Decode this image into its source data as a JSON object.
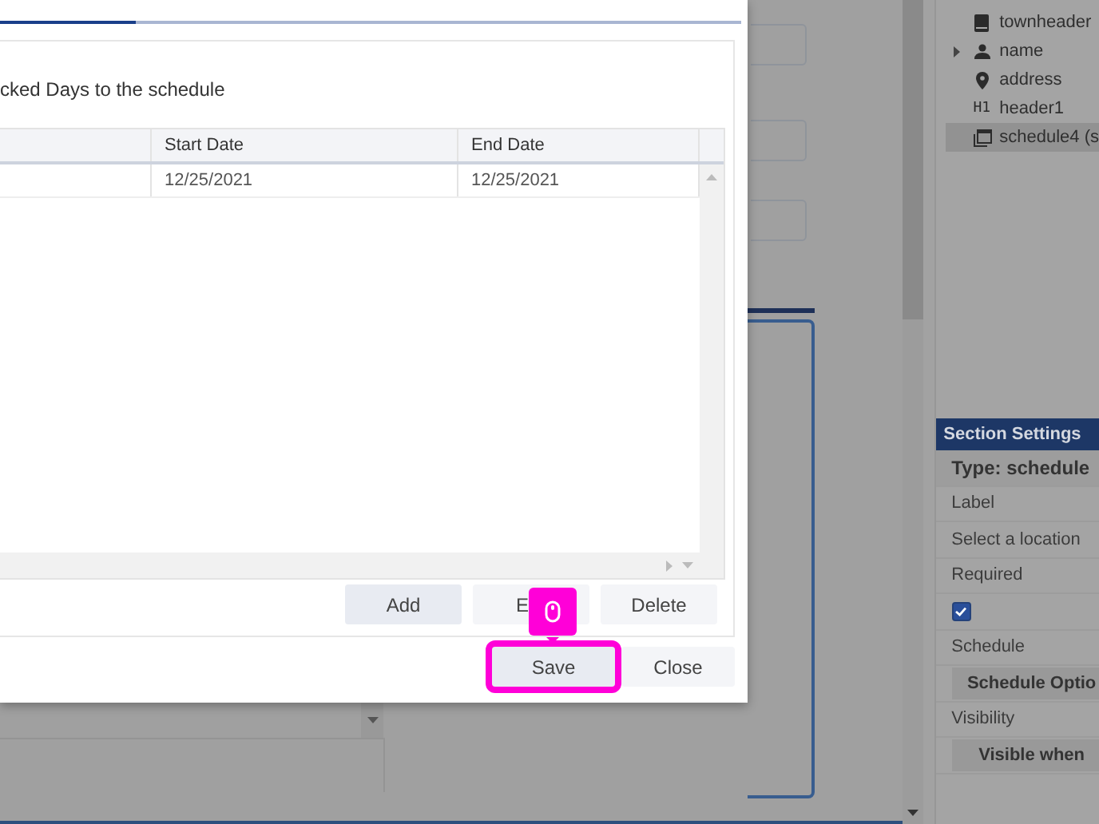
{
  "dialog": {
    "intro": "cked Days to the schedule",
    "table": {
      "columns": [
        {
          "label": "Start Date"
        },
        {
          "label": "End Date"
        }
      ],
      "rows": [
        {
          "cells": [
            "12/25/2021",
            "12/25/2021"
          ]
        }
      ]
    },
    "actions": [
      {
        "label": "Add",
        "highlighted": true
      },
      {
        "label": "E",
        "highlighted": false
      },
      {
        "label": "Delete",
        "highlighted": false
      }
    ],
    "footer_buttons": [
      {
        "label": "Save",
        "highlighted": true
      },
      {
        "label": "Close",
        "highlighted": false
      }
    ]
  },
  "tree": {
    "items": [
      {
        "label": "townheader",
        "expandable": false,
        "selected": false
      },
      {
        "label": "name",
        "expandable": true,
        "selected": false
      },
      {
        "label": "address",
        "expandable": false,
        "selected": false
      },
      {
        "label": "header1",
        "badge": "H1",
        "expandable": false,
        "selected": false
      },
      {
        "label": "schedule4 (s",
        "expandable": false,
        "selected": true
      }
    ]
  },
  "section_settings": {
    "title": "Section Settings",
    "items": [
      {
        "kind": "heading",
        "text": "Type: schedule"
      },
      {
        "kind": "label",
        "text": "Label"
      },
      {
        "kind": "label",
        "text": "Select a location"
      },
      {
        "kind": "label",
        "text": "Required"
      },
      {
        "kind": "checkbox",
        "checked": true
      },
      {
        "kind": "label",
        "text": "Schedule"
      },
      {
        "kind": "button",
        "text": "Schedule Optio"
      },
      {
        "kind": "label",
        "text": "Visibility"
      },
      {
        "kind": "button",
        "text": "Visible when"
      }
    ]
  }
}
